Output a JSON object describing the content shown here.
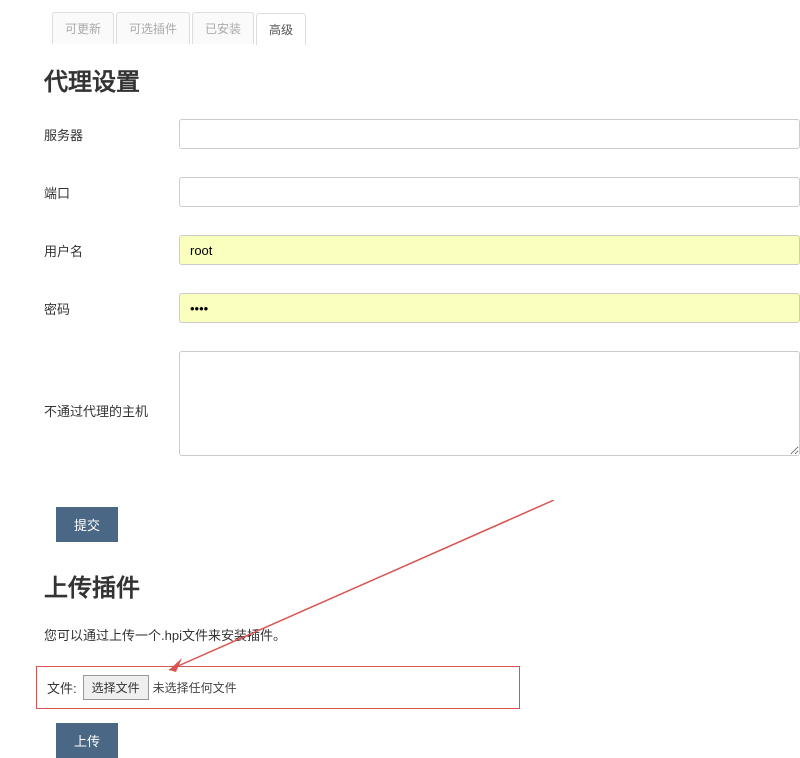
{
  "tabs": {
    "updates": "可更新",
    "available": "可选插件",
    "installed": "已安装",
    "advanced": "高级"
  },
  "headings": {
    "proxy_settings": "代理设置",
    "upload_plugin": "上传插件"
  },
  "form": {
    "server_label": "服务器",
    "server_value": "",
    "port_label": "端口",
    "port_value": "",
    "username_label": "用户名",
    "username_value": "root",
    "password_label": "密码",
    "password_value": "••••",
    "noproxy_label": "不通过代理的主机",
    "noproxy_value": ""
  },
  "buttons": {
    "submit": "提交",
    "upload": "上传",
    "choose_file": "选择文件"
  },
  "upload": {
    "description": "您可以通过上传一个.hpi文件来安装插件。",
    "file_label": "文件:",
    "file_status": "未选择任何文件"
  },
  "colors": {
    "primary_button": "#4a6785",
    "autofill_bg": "#faffbd",
    "highlight_border": "#d9534f"
  }
}
